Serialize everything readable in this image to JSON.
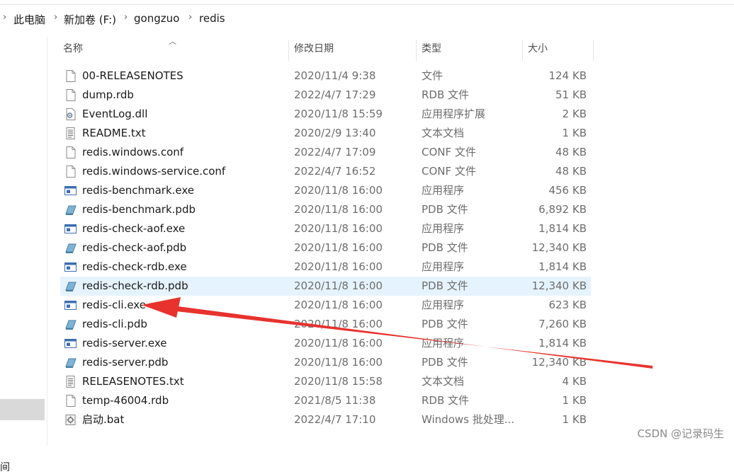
{
  "breadcrumb": [
    "此电脑",
    "新加卷 (F:)",
    "gongzuo",
    "redis"
  ],
  "columns": {
    "name": "名称",
    "date": "修改日期",
    "type": "类型",
    "size": "大小"
  },
  "nav": {
    "time_label": "间"
  },
  "files": [
    {
      "name": "00-RELEASENOTES",
      "date": "2020/11/4 9:38",
      "type": "文件",
      "size": "124 KB",
      "icon": "blank-file-icon"
    },
    {
      "name": "dump.rdb",
      "date": "2022/4/7 17:29",
      "type": "RDB 文件",
      "size": "51 KB",
      "icon": "blank-file-icon"
    },
    {
      "name": "EventLog.dll",
      "date": "2020/11/8 15:59",
      "type": "应用程序扩展",
      "size": "2 KB",
      "icon": "dll-file-icon"
    },
    {
      "name": "README.txt",
      "date": "2020/2/9 13:40",
      "type": "文本文档",
      "size": "1 KB",
      "icon": "text-file-icon"
    },
    {
      "name": "redis.windows.conf",
      "date": "2022/4/7 17:09",
      "type": "CONF 文件",
      "size": "48 KB",
      "icon": "blank-file-icon"
    },
    {
      "name": "redis.windows-service.conf",
      "date": "2022/4/7 16:52",
      "type": "CONF 文件",
      "size": "48 KB",
      "icon": "blank-file-icon"
    },
    {
      "name": "redis-benchmark.exe",
      "date": "2020/11/8 16:00",
      "type": "应用程序",
      "size": "456 KB",
      "icon": "exe-file-icon"
    },
    {
      "name": "redis-benchmark.pdb",
      "date": "2020/11/8 16:00",
      "type": "PDB 文件",
      "size": "6,892 KB",
      "icon": "pdb-file-icon"
    },
    {
      "name": "redis-check-aof.exe",
      "date": "2020/11/8 16:00",
      "type": "应用程序",
      "size": "1,814 KB",
      "icon": "exe-file-icon"
    },
    {
      "name": "redis-check-aof.pdb",
      "date": "2020/11/8 16:00",
      "type": "PDB 文件",
      "size": "12,340 KB",
      "icon": "pdb-file-icon"
    },
    {
      "name": "redis-check-rdb.exe",
      "date": "2020/11/8 16:00",
      "type": "应用程序",
      "size": "1,814 KB",
      "icon": "exe-file-icon"
    },
    {
      "name": "redis-check-rdb.pdb",
      "date": "2020/11/8 16:00",
      "type": "PDB 文件",
      "size": "12,340 KB",
      "icon": "pdb-file-icon"
    },
    {
      "name": "redis-cli.exe",
      "date": "2020/11/8 16:00",
      "type": "应用程序",
      "size": "623 KB",
      "icon": "exe-file-icon"
    },
    {
      "name": "redis-cli.pdb",
      "date": "2020/11/8 16:00",
      "type": "PDB 文件",
      "size": "7,260 KB",
      "icon": "pdb-file-icon"
    },
    {
      "name": "redis-server.exe",
      "date": "2020/11/8 16:00",
      "type": "应用程序",
      "size": "1,814 KB",
      "icon": "exe-file-icon"
    },
    {
      "name": "redis-server.pdb",
      "date": "2020/11/8 16:00",
      "type": "PDB 文件",
      "size": "12,340 KB",
      "icon": "pdb-file-icon"
    },
    {
      "name": "RELEASENOTES.txt",
      "date": "2020/11/8 15:58",
      "type": "文本文档",
      "size": "4 KB",
      "icon": "text-file-icon"
    },
    {
      "name": "temp-46004.rdb",
      "date": "2021/8/5 11:38",
      "type": "RDB 文件",
      "size": "1 KB",
      "icon": "blank-file-icon"
    },
    {
      "name": "启动.bat",
      "date": "2022/4/7 17:10",
      "type": "Windows 批处理...",
      "size": "1 KB",
      "icon": "bat-file-icon"
    }
  ],
  "hovered_file": "redis-check-rdb.pdb",
  "annotation": {
    "arrow_color": "#e8322d",
    "points_to": "redis-cli.exe"
  },
  "watermark": "CSDN @记录码生"
}
